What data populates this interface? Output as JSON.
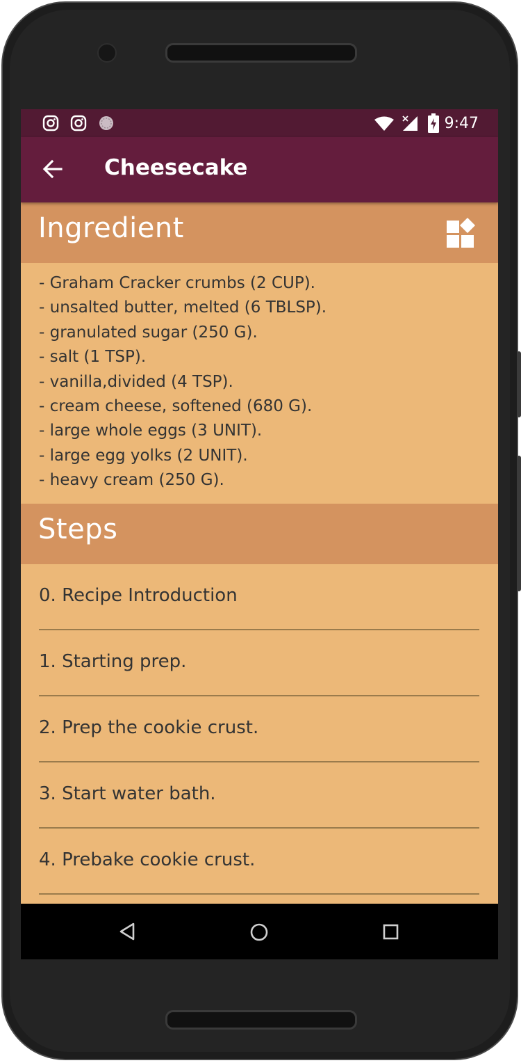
{
  "appbar": {
    "title": "Cheesecake"
  },
  "status": {
    "time": "9:47"
  },
  "ingredient_section": {
    "title": "Ingredient"
  },
  "ingredients": [
    "- Graham Cracker crumbs (2 CUP).",
    "- unsalted butter, melted (6 TBLSP).",
    "- granulated sugar (250 G).",
    "- salt (1 TSP).",
    "- vanilla,divided (4 TSP).",
    "- cream cheese, softened (680 G).",
    "- large whole eggs (3 UNIT).",
    "- large egg yolks (2 UNIT).",
    "- heavy cream (250 G)."
  ],
  "steps_section": {
    "title": "Steps"
  },
  "steps": [
    "0. Recipe Introduction",
    "1. Starting prep.",
    "2. Prep the cookie crust.",
    "3. Start water bath.",
    "4. Prebake cookie crust."
  ],
  "colors": {
    "status_bar": "#521a33",
    "app_bar": "#641d3d",
    "section_header": "#d4935f",
    "content_bg": "#ecb878",
    "divider": "#9a7b4c"
  },
  "icons": {
    "status_left": [
      "instagram-icon",
      "instagram-icon",
      "notification-circle-icon"
    ],
    "status_right": [
      "wifi-icon",
      "no-signal-icon",
      "battery-charging-icon"
    ],
    "appbar": "back-arrow-icon",
    "ingredient_action": "widget-icon",
    "nav": [
      "back-triangle-icon",
      "home-circle-icon",
      "recents-square-icon"
    ]
  }
}
